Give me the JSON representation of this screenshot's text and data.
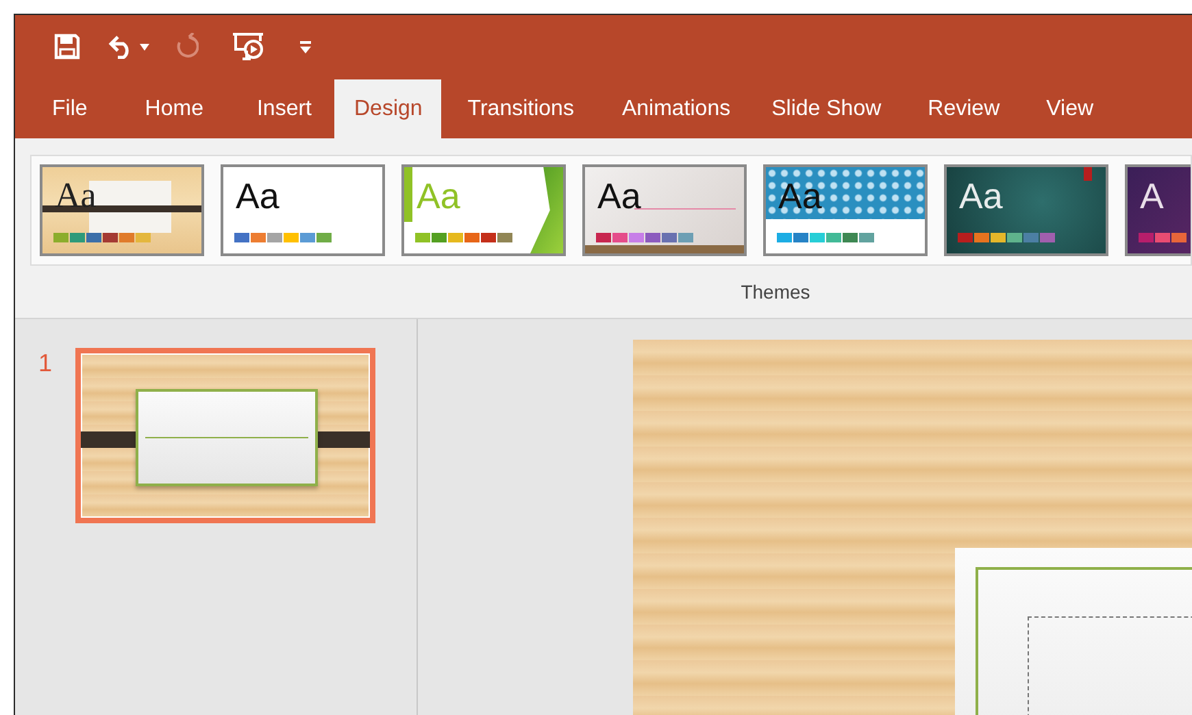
{
  "quick_access": [
    {
      "kind": "save",
      "disabled": false
    },
    {
      "kind": "undo",
      "disabled": false
    },
    {
      "kind": "undo-menu",
      "disabled": false
    },
    {
      "kind": "redo",
      "disabled": true
    },
    {
      "kind": "present",
      "disabled": false
    },
    {
      "kind": "customize",
      "disabled": false
    }
  ],
  "tabs": [
    {
      "label": "File",
      "selected": false
    },
    {
      "label": "Home",
      "selected": false
    },
    {
      "label": "Insert",
      "selected": false
    },
    {
      "label": "Design",
      "selected": true
    },
    {
      "label": "Transitions",
      "selected": false
    },
    {
      "label": "Animations",
      "selected": false
    },
    {
      "label": "Slide Show",
      "selected": false
    },
    {
      "label": "Review",
      "selected": false
    },
    {
      "label": "View",
      "selected": false
    }
  ],
  "themes": {
    "label": "Themes",
    "items": [
      {
        "kind": "wood",
        "sample": "Aa",
        "swatches": [
          {
            "color": "#8cad2c"
          },
          {
            "color": "#2e9a7a"
          },
          {
            "color": "#3c6fa9"
          },
          {
            "color": "#a43a33"
          },
          {
            "color": "#e07b2a"
          },
          {
            "color": "#e4b73d"
          }
        ]
      },
      {
        "kind": "plain",
        "sample": "Aa",
        "swatches": [
          {
            "color": "#4472c4"
          },
          {
            "color": "#ed7d31"
          },
          {
            "color": "#a5a5a5"
          },
          {
            "color": "#ffc000"
          },
          {
            "color": "#5b9bd5"
          },
          {
            "color": "#70ad47"
          }
        ]
      },
      {
        "kind": "facet",
        "sample": "Aa",
        "swatches": [
          {
            "color": "#90c226"
          },
          {
            "color": "#54a021"
          },
          {
            "color": "#e6b91e"
          },
          {
            "color": "#e76618"
          },
          {
            "color": "#c42f1a"
          },
          {
            "color": "#918655"
          }
        ]
      },
      {
        "kind": "paper",
        "sample": "Aa",
        "swatches": [
          {
            "color": "#c8264f"
          },
          {
            "color": "#e54c8a"
          },
          {
            "color": "#c77ee8"
          },
          {
            "color": "#8c5bbe"
          },
          {
            "color": "#6971b0"
          },
          {
            "color": "#6d9fb4"
          }
        ]
      },
      {
        "kind": "pattern",
        "sample": "Aa",
        "swatches": [
          {
            "color": "#1cade4"
          },
          {
            "color": "#2683c6"
          },
          {
            "color": "#27ced7"
          },
          {
            "color": "#42ba97"
          },
          {
            "color": "#3e8853"
          },
          {
            "color": "#62a39f"
          }
        ]
      },
      {
        "kind": "teal",
        "sample": "Aa",
        "swatches": [
          {
            "color": "#b71e1e"
          },
          {
            "color": "#e7731f"
          },
          {
            "color": "#e5b72a"
          },
          {
            "color": "#5fb38c"
          },
          {
            "color": "#4c7fa4"
          },
          {
            "color": "#a05fae"
          }
        ]
      },
      {
        "kind": "purple",
        "sample": "A",
        "swatches": [
          {
            "color": "#b71e6b"
          },
          {
            "color": "#e94c72"
          },
          {
            "color": "#e8663a"
          }
        ]
      }
    ]
  },
  "slides": [
    {
      "number": "1",
      "selected": true
    }
  ]
}
